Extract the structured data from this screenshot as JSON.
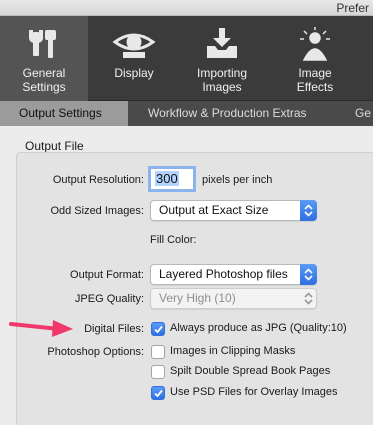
{
  "window": {
    "title": "Prefer"
  },
  "toolbar": {
    "items": [
      {
        "label_line1": "General",
        "label_line2": "Settings",
        "icon": "wrench-icon"
      },
      {
        "label_line1": "Display",
        "label_line2": "",
        "icon": "eye-icon"
      },
      {
        "label_line1": "Importing",
        "label_line2": "Images",
        "icon": "import-icon"
      },
      {
        "label_line1": "Image",
        "label_line2": "Effects",
        "icon": "effects-icon"
      }
    ]
  },
  "tabs": [
    {
      "label": "Output Settings"
    },
    {
      "label": "Workflow & Production Extras"
    },
    {
      "label": "Ge"
    }
  ],
  "section": {
    "title": "Output File"
  },
  "fields": {
    "output_resolution": {
      "label": "Output Resolution:",
      "value": "300",
      "unit": "pixels per inch"
    },
    "odd_sized_images": {
      "label": "Odd Sized Images:",
      "value": "Output at Exact Size"
    },
    "fill_color": {
      "label": "Fill Color:"
    },
    "output_format": {
      "label": "Output Format:",
      "value": "Layered Photoshop files"
    },
    "jpeg_quality": {
      "label": "JPEG Quality:",
      "value": "Very High (10)"
    },
    "digital_files": {
      "label": "Digital Files:",
      "option": "Always produce as JPG (Quality:10)",
      "checked": true
    },
    "photoshop_options": {
      "label": "Photoshop Options:",
      "options": [
        {
          "label": "Images in Clipping Masks",
          "checked": false
        },
        {
          "label": "Spilt Double Spread Book Pages",
          "checked": false
        },
        {
          "label": "Use PSD Files for Overlay Images",
          "checked": true
        }
      ]
    }
  },
  "colors": {
    "accent": "#2f6fe0",
    "annotation_arrow": "#f0386b",
    "toolbar_bg": "#3b3b3b"
  }
}
